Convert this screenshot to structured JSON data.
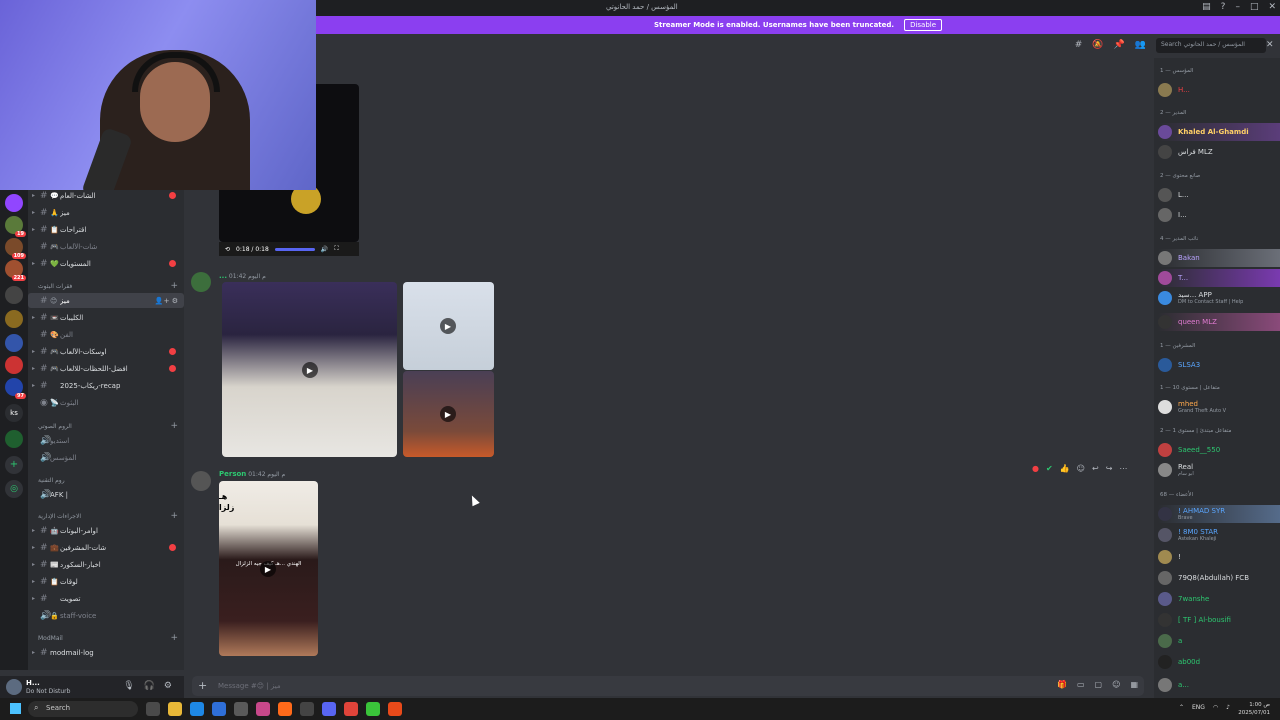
{
  "window": {
    "title": "المؤسس / حمد الحانوتي"
  },
  "banner": {
    "text": "Streamer Mode is enabled. Usernames have been truncated.",
    "disable_label": "Disable"
  },
  "server_rail": {
    "badges": [
      "19",
      "109",
      "221",
      "97"
    ],
    "label_ks": "ks"
  },
  "channels": {
    "items": [
      {
        "name": "الشات-العام",
        "emoji": "💬",
        "unread": true
      },
      {
        "name": "ميز",
        "emoji": "🙏",
        "unread": false
      },
      {
        "name": "اقتراحات",
        "emoji": "📋",
        "unread": false
      },
      {
        "name": "شات-الألعاب",
        "emoji": "🎮",
        "unread": false,
        "muted": true
      },
      {
        "name": "المستويات",
        "emoji": "💚",
        "unread": true
      },
      {
        "name": "ميز",
        "emoji": "😊",
        "active": true
      },
      {
        "name": "الكليبات",
        "emoji": "📼",
        "unread": false
      },
      {
        "name": "الفن",
        "emoji": "🎨",
        "unread": false,
        "muted": true
      },
      {
        "name": "اوسكات-الألعاب",
        "emoji": "🎮",
        "unread": true
      },
      {
        "name": "افضل-اللحظات-للالعاب",
        "emoji": "🎮",
        "unread": true
      },
      {
        "name": "2025-ريكاب-recap",
        "emoji": "",
        "unread": false
      },
      {
        "name": "البثوث",
        "emoji": "📡",
        "unread": false,
        "muted": true
      }
    ],
    "cat_bots": "فقرات البثوث",
    "cat_voice": "الروم الصوتي",
    "voice_items": [
      "استديو",
      "المؤسس"
    ],
    "cat_afk": "روم التقنية",
    "afk_item": "AFK |",
    "cat_admin": "الاجراءات الإدارية",
    "admin_items": [
      {
        "name": "اوامر-البوتات",
        "emoji": "🤖",
        "unread": false
      },
      {
        "name": "شات-المشرفين",
        "emoji": "💼",
        "unread": true
      },
      {
        "name": "اخبار-السكورد",
        "emoji": "📰",
        "unread": false
      },
      {
        "name": "لوقات",
        "emoji": "📋",
        "unread": false
      },
      {
        "name": "تصويت",
        "emoji": "",
        "unread": false
      },
      {
        "name": "staff-voice",
        "emoji": "🔒",
        "unread": false,
        "muted": true
      }
    ],
    "cat_modmail": "ModMail",
    "modmail_item": "modmail-log"
  },
  "userpanel": {
    "name": "H...",
    "status": "Do Not Disturb"
  },
  "search": {
    "placeholder": "Search المؤسس / حمد الحانوتي"
  },
  "messages": {
    "video1": {
      "time_label": "0:18 / 0:18"
    },
    "msg2": {
      "author": "...",
      "time": "01:42 م اليوم"
    },
    "msg3": {
      "author": "Person",
      "time": "01:42 م اليوم",
      "overlay_text": "هـ\nزلزا",
      "caption": "الهندي ...هـ كيف جيه الزلزال"
    }
  },
  "composer": {
    "placeholder": "Message #😊 | ميز"
  },
  "members": {
    "groups": [
      {
        "label": "المؤسس — 1",
        "items": [
          {
            "name": "H...",
            "color": "#f23f43"
          }
        ]
      },
      {
        "label": "المدير — 2",
        "items": [
          {
            "name": "Khaled Al-Ghamdi",
            "color": "#ffd166"
          },
          {
            "name": "فراس MLZ",
            "color": "#dbdee1"
          }
        ]
      },
      {
        "label": "صانع محتوى — 2",
        "items": [
          {
            "name": "L...",
            "color": "#dbdee1"
          },
          {
            "name": "I...",
            "color": "#dbdee1"
          }
        ]
      },
      {
        "label": "نائب المدير — 4",
        "items": [
          {
            "name": "Bakan",
            "color": "#b9a3ff"
          },
          {
            "name": "T...",
            "color": "#b9a3ff"
          },
          {
            "name": "سيد... APP",
            "sub": "DM to Contact Staff | Help",
            "color": "#dbdee1"
          },
          {
            "name": "queen MLZ",
            "color": "#e07bd1"
          }
        ]
      },
      {
        "label": "المشرفين — 1",
        "items": [
          {
            "name": "SLSA3",
            "color": "#5aa6ff"
          }
        ]
      },
      {
        "label": "متفاعل | مستوى 10 — 1",
        "items": [
          {
            "name": "mhed",
            "sub": "Grand Theft Auto V",
            "color": "#ffa94d"
          }
        ]
      },
      {
        "label": "متفاعل مبتدئ | مستوى 1 — 2",
        "items": [
          {
            "name": "Saeed__550",
            "color": "#2dc770"
          },
          {
            "name": "Real",
            "sub": "ابو سام",
            "color": "#dbdee1"
          }
        ]
      },
      {
        "label": "الأعضاء — 68",
        "items": [
          {
            "name": "! AHMAD SYR",
            "sub": "Brave",
            "color": "#5aa6ff"
          },
          {
            "name": "! 8M0 STAR",
            "sub": "Astekan Khaleji",
            "color": "#5aa6ff"
          },
          {
            "name": "!",
            "color": "#dbdee1"
          },
          {
            "name": "79Q8(Abdullah) FCB",
            "color": "#dbdee1"
          },
          {
            "name": "7wanshe",
            "color": "#2dc770"
          },
          {
            "name": "[ TF ] Al-bousifi",
            "color": "#2dc770"
          },
          {
            "name": "a",
            "color": "#2dc770"
          },
          {
            "name": "ab00d",
            "color": "#2dc770"
          },
          {
            "name": "a...",
            "color": "#2dc770"
          }
        ]
      }
    ]
  },
  "taskbar": {
    "search_label": "Search",
    "lang": "ENG",
    "time": "1:00 ص",
    "date": "2025/07/01"
  }
}
